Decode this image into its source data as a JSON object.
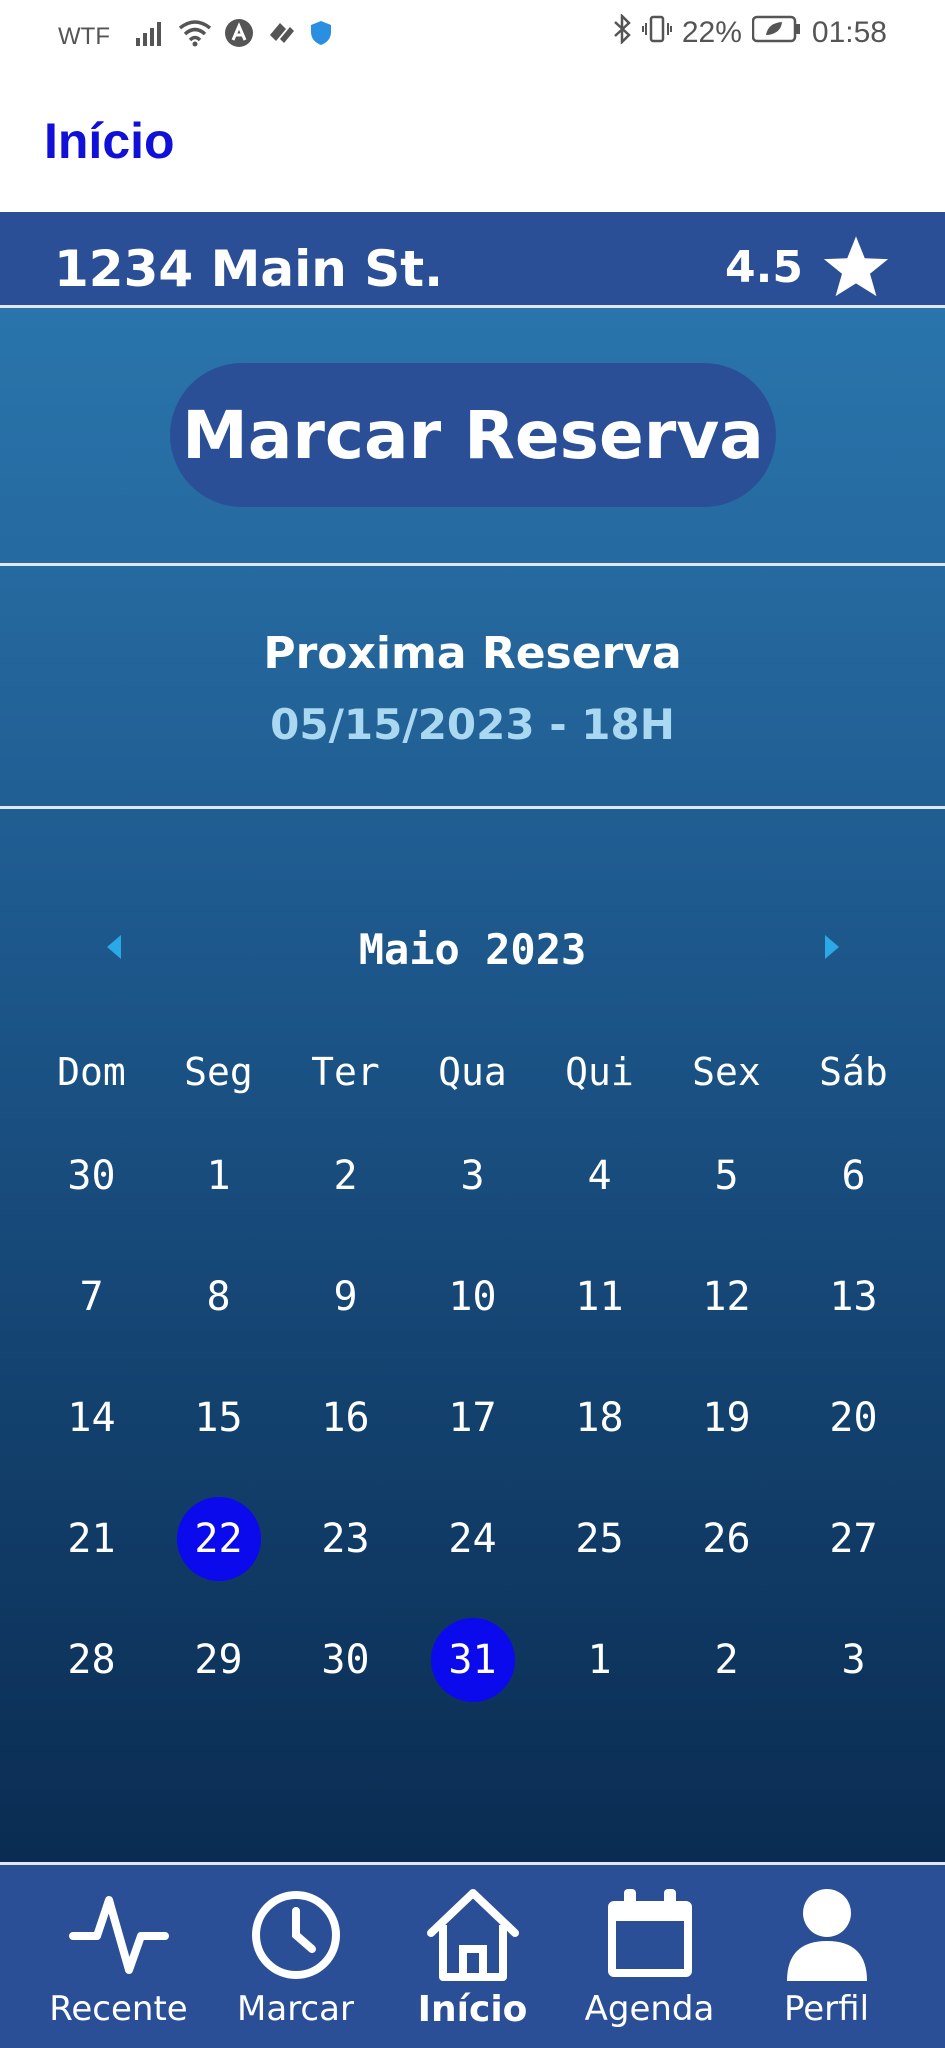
{
  "status_bar": {
    "carrier": "WTF",
    "battery": "22%",
    "time": "01:58"
  },
  "appbar": {
    "title": "Início"
  },
  "venue": {
    "address": "1234 Main St.",
    "rating": "4.5"
  },
  "reserve_button": {
    "label": "Marcar Reserva"
  },
  "next_reservation": {
    "title": "Proxima Reserva",
    "date": "05/15/2023 - 18H"
  },
  "calendar": {
    "month": "Maio 2023",
    "weekdays": [
      "Dom",
      "Seg",
      "Ter",
      "Qua",
      "Qui",
      "Sex",
      "Sáb"
    ],
    "weeks": [
      [
        "30",
        "1",
        "2",
        "3",
        "4",
        "5",
        "6"
      ],
      [
        "7",
        "8",
        "9",
        "10",
        "11",
        "12",
        "13"
      ],
      [
        "14",
        "15",
        "16",
        "17",
        "18",
        "19",
        "20"
      ],
      [
        "21",
        "22",
        "23",
        "24",
        "25",
        "26",
        "27"
      ],
      [
        "28",
        "29",
        "30",
        "31",
        "1",
        "2",
        "3"
      ]
    ],
    "selected_days": [
      "22",
      "31"
    ]
  },
  "bottom_nav": {
    "items": [
      {
        "label": "Recente",
        "icon": "activity-icon"
      },
      {
        "label": "Marcar",
        "icon": "clock-icon"
      },
      {
        "label": "Início",
        "icon": "home-icon",
        "active": true
      },
      {
        "label": "Agenda",
        "icon": "calendar-icon"
      },
      {
        "label": "Perfil",
        "icon": "user-icon"
      }
    ]
  },
  "colors": {
    "primary": "#2b4f96",
    "title_blue": "#1010d8",
    "selected_day": "#0a0aec",
    "date_accent": "#a9d8f0"
  }
}
